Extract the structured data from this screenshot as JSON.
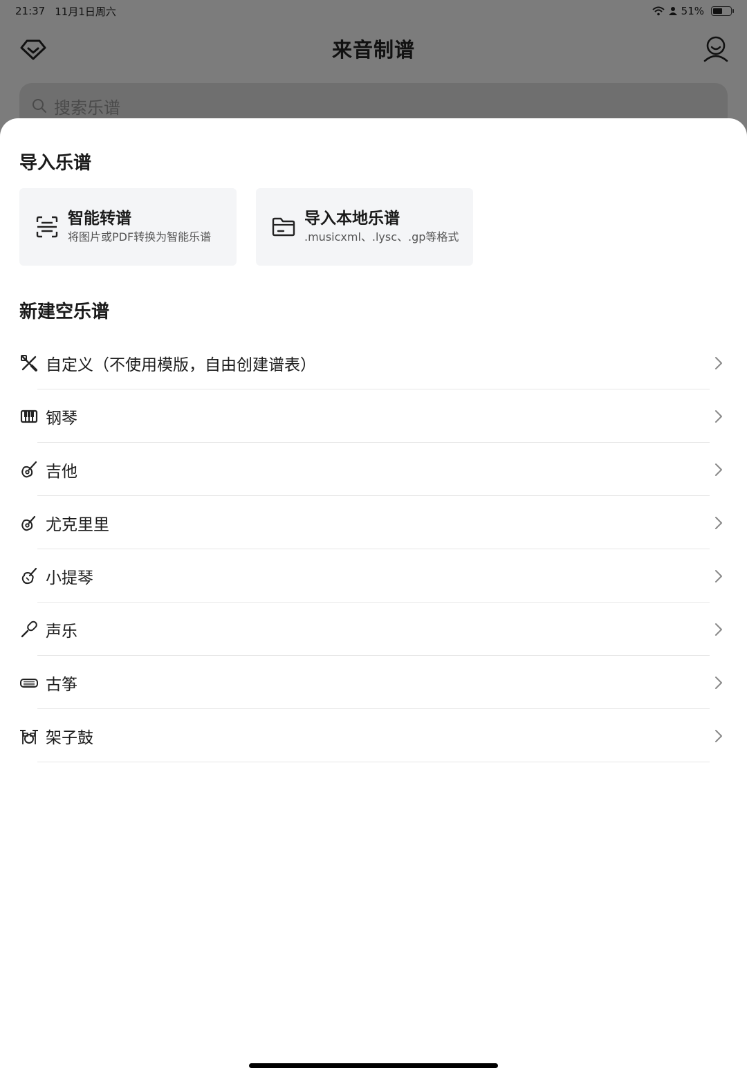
{
  "status_bar": {
    "time": "21:37",
    "date": "11月1日周六",
    "battery": "51%",
    "battery_level": 0.51
  },
  "header": {
    "title": "来音制谱",
    "left_icon": "vip-diamond-icon",
    "right_icon": "user-profile-icon"
  },
  "search": {
    "placeholder": "搜索乐谱"
  },
  "sheet": {
    "import_section_title": "导入乐谱",
    "cards": [
      {
        "title": "智能转谱",
        "subtitle": "将图片或PDF转换为智能乐谱",
        "icon": "scan-icon"
      },
      {
        "title": "导入本地乐谱",
        "subtitle": ".musicxml、.lysc、.gp等格式",
        "icon": "folder-icon"
      }
    ],
    "new_section_title": "新建空乐谱",
    "items": [
      {
        "label": "自定义（不使用模版，自由创建谱表）",
        "icon": "tools-icon"
      },
      {
        "label": "钢琴",
        "icon": "piano-icon"
      },
      {
        "label": "吉他",
        "icon": "guitar-icon"
      },
      {
        "label": "尤克里里",
        "icon": "ukulele-icon"
      },
      {
        "label": "小提琴",
        "icon": "violin-icon"
      },
      {
        "label": "声乐",
        "icon": "microphone-icon"
      },
      {
        "label": "古筝",
        "icon": "guzheng-icon"
      },
      {
        "label": "架子鼓",
        "icon": "drum-kit-icon"
      }
    ]
  }
}
